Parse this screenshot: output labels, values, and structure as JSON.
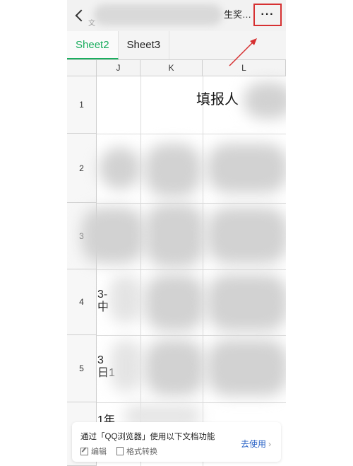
{
  "header": {
    "title_fragment": "文",
    "title_tail": "生奖…",
    "more_label": "···"
  },
  "tabs": [
    {
      "label": "Sheet2",
      "active": true
    },
    {
      "label": "Sheet3",
      "active": false
    }
  ],
  "grid": {
    "columns": [
      "J",
      "K",
      "L"
    ],
    "rows": [
      "1",
      "2",
      "3",
      "4",
      "5"
    ],
    "cell_fill_reporter": "填报人",
    "cell_r4": "3-\n中",
    "cell_r5": "3\n日1",
    "cell_r6": "1年"
  },
  "banner": {
    "message": "通过「QQ浏览器」使用以下文档功能",
    "action_edit": "编辑",
    "action_convert": "格式转换",
    "cta": "去使用"
  },
  "colors": {
    "accent_green": "#1aad5e",
    "annotation_red": "#d63031",
    "link_blue": "#2a63c6"
  }
}
